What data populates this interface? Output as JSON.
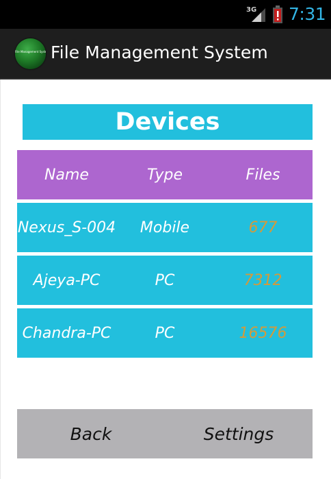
{
  "status_bar": {
    "network": "3G",
    "time": "7:31",
    "icons": [
      "signal-icon",
      "battery-alert-icon"
    ],
    "clock_color": "#33b5e5"
  },
  "action_bar": {
    "icon_text": "File Management System",
    "title": "File Management System"
  },
  "devices": {
    "title": "Devices",
    "columns": [
      "Name",
      "Type",
      "Files"
    ],
    "rows": [
      {
        "name": "Nexus_S-004",
        "type": "Mobile",
        "files": "677"
      },
      {
        "name": "Ajeya-PC",
        "type": "PC",
        "files": "7312"
      },
      {
        "name": "Chandra-PC",
        "type": "PC",
        "files": "16576"
      }
    ]
  },
  "buttons": {
    "back": "Back",
    "settings": "Settings"
  },
  "colors": {
    "accent_cyan": "#22bfdd",
    "header_purple": "#ad66cf",
    "files_orange": "#d49a3a",
    "button_bar_gray": "#b3b2b5"
  }
}
